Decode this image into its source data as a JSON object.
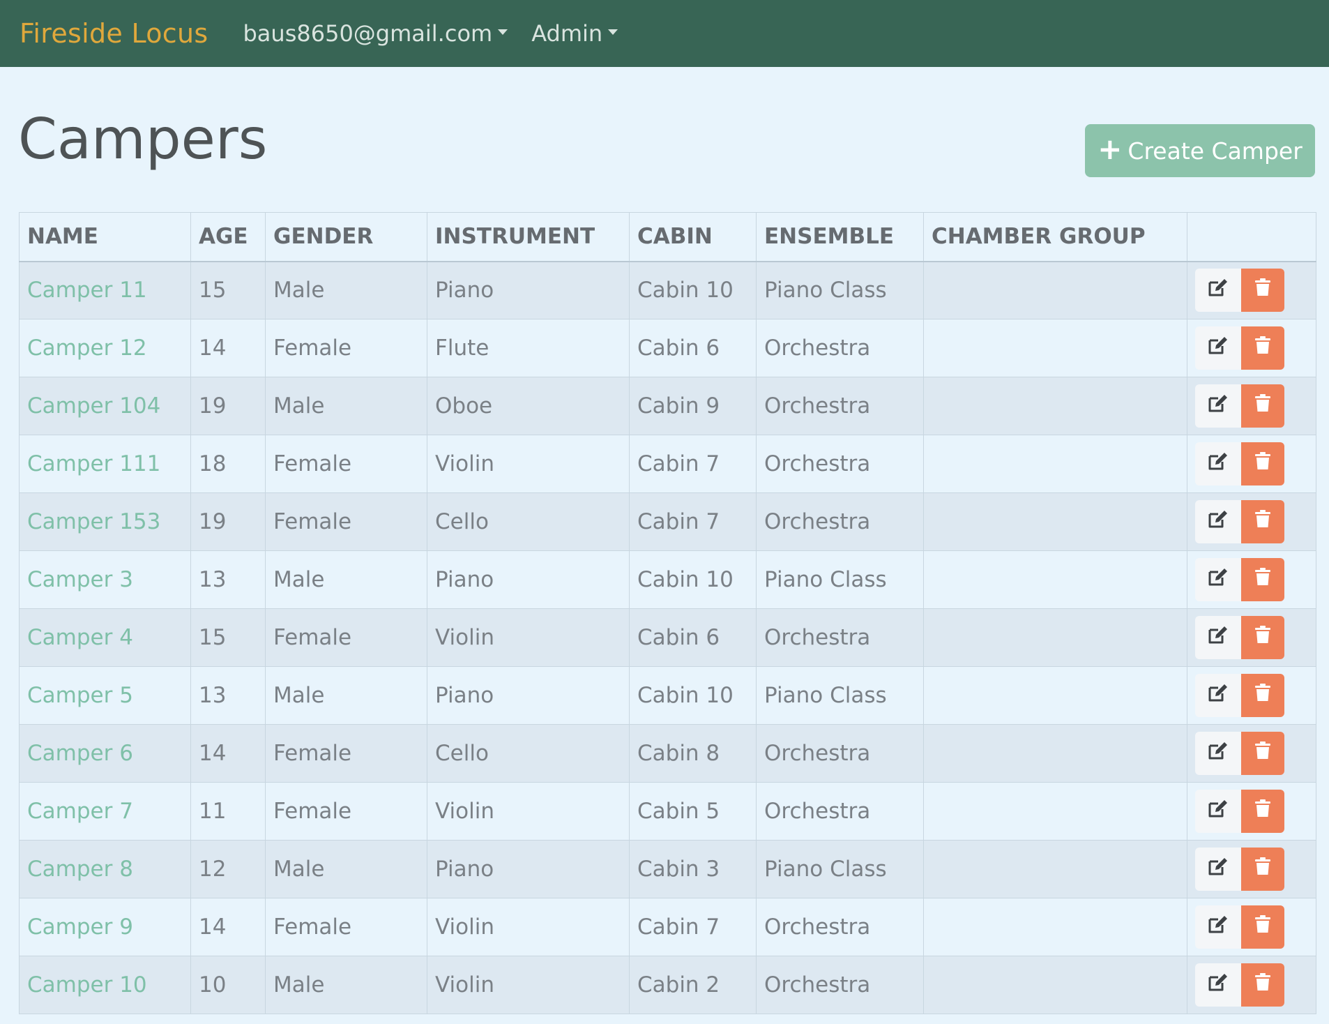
{
  "navbar": {
    "brand": "Fireside Locus",
    "user_menu": "baus8650@gmail.com",
    "admin_menu": "Admin"
  },
  "page": {
    "title": "Campers",
    "create_button": "Create Camper"
  },
  "table": {
    "columns": [
      "NAME",
      "AGE",
      "GENDER",
      "INSTRUMENT",
      "CABIN",
      "ENSEMBLE",
      "CHAMBER GROUP",
      ""
    ],
    "rows": [
      {
        "name": "Camper 11",
        "age": "15",
        "gender": "Male",
        "instrument": "Piano",
        "cabin": "Cabin 10",
        "ensemble": "Piano Class",
        "chamber_group": ""
      },
      {
        "name": "Camper 12",
        "age": "14",
        "gender": "Female",
        "instrument": "Flute",
        "cabin": "Cabin 6",
        "ensemble": "Orchestra",
        "chamber_group": ""
      },
      {
        "name": "Camper 104",
        "age": "19",
        "gender": "Male",
        "instrument": "Oboe",
        "cabin": "Cabin 9",
        "ensemble": "Orchestra",
        "chamber_group": ""
      },
      {
        "name": "Camper 111",
        "age": "18",
        "gender": "Female",
        "instrument": "Violin",
        "cabin": "Cabin 7",
        "ensemble": "Orchestra",
        "chamber_group": ""
      },
      {
        "name": "Camper 153",
        "age": "19",
        "gender": "Female",
        "instrument": "Cello",
        "cabin": "Cabin 7",
        "ensemble": "Orchestra",
        "chamber_group": ""
      },
      {
        "name": "Camper 3",
        "age": "13",
        "gender": "Male",
        "instrument": "Piano",
        "cabin": "Cabin 10",
        "ensemble": "Piano Class",
        "chamber_group": ""
      },
      {
        "name": "Camper 4",
        "age": "15",
        "gender": "Female",
        "instrument": "Violin",
        "cabin": "Cabin 6",
        "ensemble": "Orchestra",
        "chamber_group": ""
      },
      {
        "name": "Camper 5",
        "age": "13",
        "gender": "Male",
        "instrument": "Piano",
        "cabin": "Cabin 10",
        "ensemble": "Piano Class",
        "chamber_group": ""
      },
      {
        "name": "Camper 6",
        "age": "14",
        "gender": "Female",
        "instrument": "Cello",
        "cabin": "Cabin 8",
        "ensemble": "Orchestra",
        "chamber_group": ""
      },
      {
        "name": "Camper 7",
        "age": "11",
        "gender": "Female",
        "instrument": "Violin",
        "cabin": "Cabin 5",
        "ensemble": "Orchestra",
        "chamber_group": ""
      },
      {
        "name": "Camper 8",
        "age": "12",
        "gender": "Male",
        "instrument": "Piano",
        "cabin": "Cabin 3",
        "ensemble": "Piano Class",
        "chamber_group": ""
      },
      {
        "name": "Camper 9",
        "age": "14",
        "gender": "Female",
        "instrument": "Violin",
        "cabin": "Cabin 7",
        "ensemble": "Orchestra",
        "chamber_group": ""
      },
      {
        "name": "Camper 10",
        "age": "10",
        "gender": "Male",
        "instrument": "Violin",
        "cabin": "Cabin 2",
        "ensemble": "Orchestra",
        "chamber_group": ""
      }
    ]
  },
  "icons": {
    "edit": "edit-icon",
    "delete": "trash-icon",
    "create": "plus-icon"
  },
  "colors": {
    "navbar": "#386555",
    "brand": "#e0a83c",
    "accent": "#8cc3ab",
    "link": "#7fc0a8",
    "danger": "#ee7f57"
  }
}
